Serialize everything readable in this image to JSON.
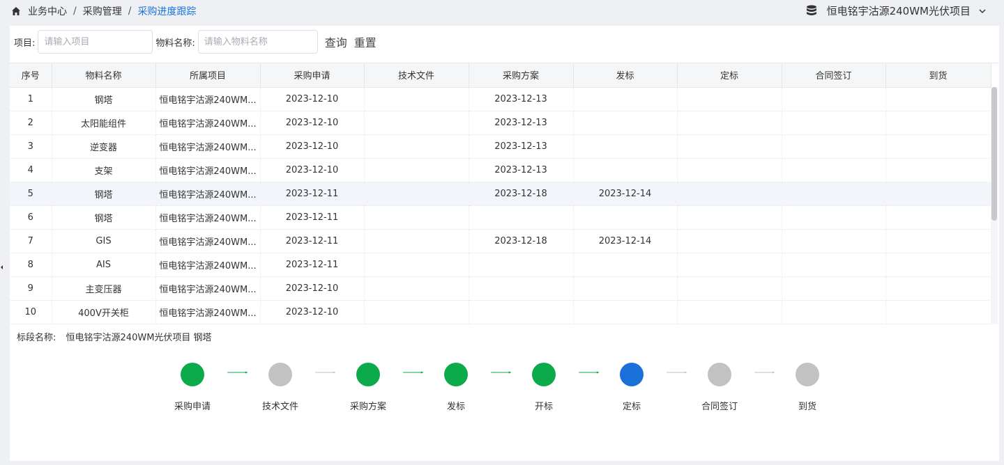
{
  "breadcrumb": {
    "items": [
      "业务中心",
      "采购管理",
      "采购进度跟踪"
    ]
  },
  "project_selector": {
    "value": "恒电铭宇沽源240WM光伏项目"
  },
  "filters": {
    "project_label": "项目:",
    "project_placeholder": "请输入项目",
    "material_label": "物料名称:",
    "material_placeholder": "请输入物料名称",
    "query_button": "查询",
    "reset_button": "重置"
  },
  "table": {
    "columns": [
      "序号",
      "物料名称",
      "所属项目",
      "采购申请",
      "技术文件",
      "采购方案",
      "发标",
      "定标",
      "合同签订",
      "到货"
    ],
    "rows": [
      [
        "1",
        "钢塔",
        "恒电铭宇沽源240WM...",
        "2023-12-10",
        "",
        "2023-12-13",
        "",
        "",
        "",
        ""
      ],
      [
        "2",
        "太阳能组件",
        "恒电铭宇沽源240WM...",
        "2023-12-10",
        "",
        "2023-12-13",
        "",
        "",
        "",
        ""
      ],
      [
        "3",
        "逆变器",
        "恒电铭宇沽源240WM...",
        "2023-12-10",
        "",
        "2023-12-13",
        "",
        "",
        "",
        ""
      ],
      [
        "4",
        "支架",
        "恒电铭宇沽源240WM...",
        "2023-12-10",
        "",
        "2023-12-13",
        "",
        "",
        "",
        ""
      ],
      [
        "5",
        "钢塔",
        "恒电铭宇沽源240WM...",
        "2023-12-11",
        "",
        "2023-12-18",
        "2023-12-14",
        "",
        "",
        ""
      ],
      [
        "6",
        "钢塔",
        "恒电铭宇沽源240WM...",
        "2023-12-11",
        "",
        "",
        "",
        "",
        "",
        ""
      ],
      [
        "7",
        "GIS",
        "恒电铭宇沽源240WM...",
        "2023-12-11",
        "",
        "2023-12-18",
        "2023-12-14",
        "",
        "",
        ""
      ],
      [
        "8",
        "AIS",
        "恒电铭宇沽源240WM...",
        "2023-12-11",
        "",
        "",
        "",
        "",
        "",
        ""
      ],
      [
        "9",
        "主变压器",
        "恒电铭宇沽源240WM...",
        "2023-12-10",
        "",
        "",
        "",
        "",
        "",
        ""
      ],
      [
        "10",
        "400V开关柜",
        "恒电铭宇沽源240WM...",
        "2023-12-10",
        "",
        "",
        "",
        "",
        "",
        ""
      ]
    ],
    "selected_row": 5
  },
  "bid_section": {
    "label": "标段名称:",
    "value": "恒电铭宇沽源240WM光伏项目 钢塔"
  },
  "progress": {
    "steps": [
      {
        "label": "采购申请",
        "status": "done"
      },
      {
        "label": "技术文件",
        "status": "pending"
      },
      {
        "label": "采购方案",
        "status": "done"
      },
      {
        "label": "发标",
        "status": "done"
      },
      {
        "label": "开标",
        "status": "done"
      },
      {
        "label": "定标",
        "status": "current"
      },
      {
        "label": "合同签订",
        "status": "pending"
      },
      {
        "label": "到货",
        "status": "pending"
      }
    ],
    "arrows": [
      "done",
      "pending",
      "done",
      "done",
      "done",
      "pending",
      "pending"
    ]
  },
  "colors": {
    "accent": "#1a73d9",
    "done": "#0daa4b",
    "current": "#1a6fd8",
    "pending": "#c2c2c2"
  }
}
